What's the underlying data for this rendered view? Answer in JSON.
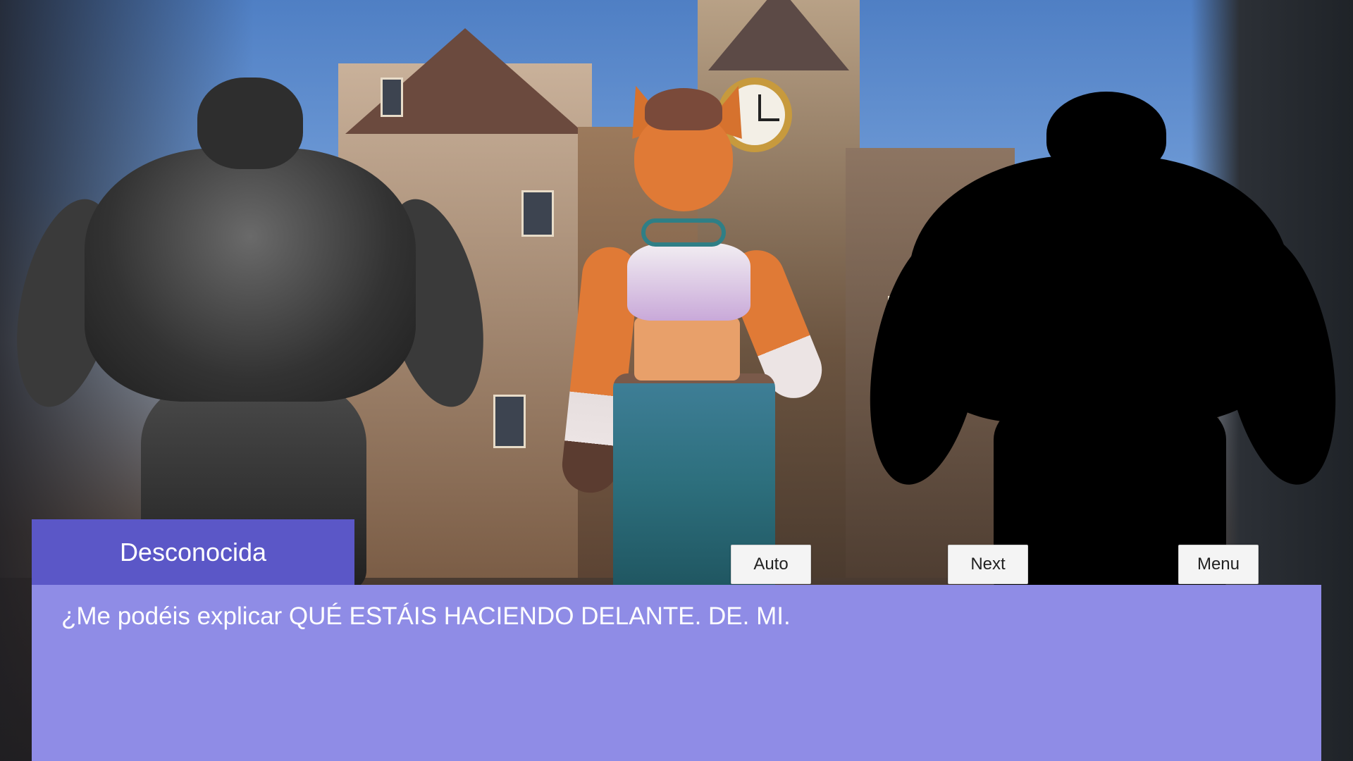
{
  "dialogue": {
    "speaker": "Desconocida",
    "text": "¿Me podéis explicar QUÉ ESTÁIS HACIENDO DELANTE. DE. MI."
  },
  "controls": {
    "auto_label": "Auto",
    "next_label": "Next",
    "menu_label": "Menu"
  },
  "colors": {
    "name_box": "#5b57c7",
    "dialogue_box": "#8f8ce6",
    "button_bg": "#f4f4f4"
  },
  "scene": {
    "background": "medieval town square with clock tower",
    "characters": [
      "grey muscular figure",
      "lynx woman",
      "black silhouette"
    ]
  }
}
